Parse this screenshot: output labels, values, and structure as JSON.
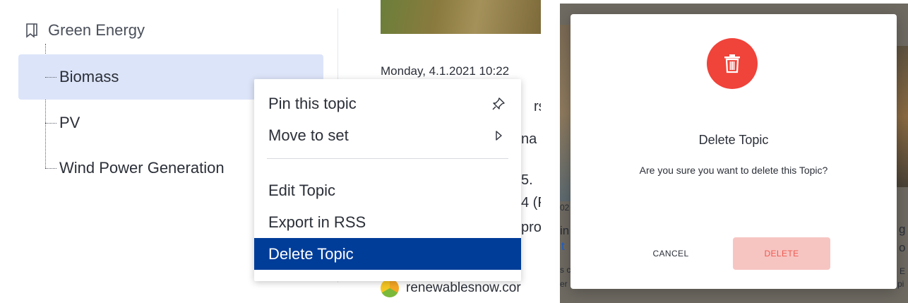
{
  "tree": {
    "root_label": "Green Energy",
    "items": [
      {
        "label": "Biomass",
        "selected": true
      },
      {
        "label": "PV",
        "selected": false
      },
      {
        "label": "Wind Power Generation",
        "selected": false
      }
    ]
  },
  "context_menu": {
    "items": [
      {
        "label": "Pin this topic",
        "icon": "pin-icon"
      },
      {
        "label": "Move to set",
        "icon": "chevron-right-icon"
      },
      {
        "label": "Edit Topic"
      },
      {
        "label": "Export in RSS"
      },
      {
        "label": "Delete Topic",
        "highlighted": true
      }
    ]
  },
  "article": {
    "date": "Monday, 4.1.2021 10:22",
    "fragments": [
      "rs",
      "na",
      "5.",
      "4 (F",
      "pro"
    ],
    "source": "renewablesnow.cor",
    "source_icon": "renewablesnow-logo-icon"
  },
  "background_fragments": [
    "02",
    "in",
    "t",
    "s c",
    "er",
    "g",
    "o",
    "E",
    "pi"
  ],
  "dialog": {
    "icon": "trash-icon",
    "title": "Delete Topic",
    "message": "Are you sure you want to delete this Topic?",
    "cancel_label": "CANCEL",
    "delete_label": "DELETE"
  },
  "colors": {
    "selection": "#dce4f9",
    "menu_highlight": "#003d99",
    "danger": "#f0433a",
    "delete_button_bg": "#f6c5c2",
    "delete_button_text": "#ef5a52"
  }
}
